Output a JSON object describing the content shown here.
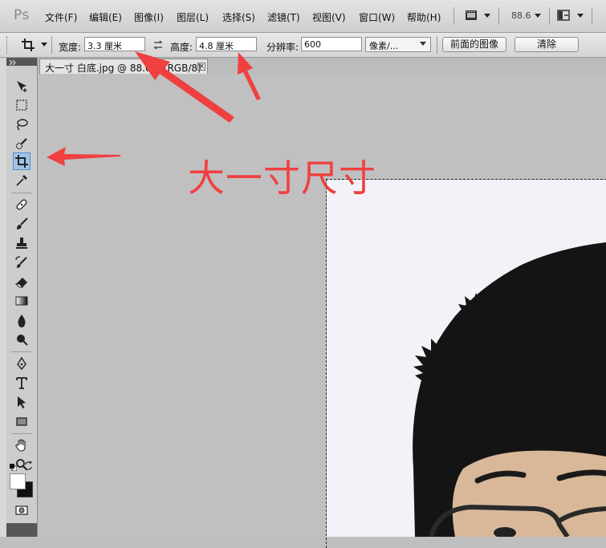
{
  "app": {
    "logo": "Ps"
  },
  "menu": {
    "items": [
      "文件(F)",
      "编辑(E)",
      "图像(I)",
      "图层(L)",
      "选择(S)",
      "滤镜(T)",
      "视图(V)",
      "窗口(W)",
      "帮助(H)"
    ],
    "zoom": "88.6"
  },
  "options": {
    "width_label": "宽度:",
    "width_value": "3.3 厘米",
    "height_label": "高度:",
    "height_value": "4.8 厘米",
    "resolution_label": "分辨率:",
    "resolution_value": "600",
    "unit_select": "像素/...",
    "front_image_button": "前面的图像",
    "clear_button": "清除"
  },
  "document": {
    "tab_title": "大一寸 白底.jpg @ 88.6% (RGB/8)",
    "tab_close": "×"
  },
  "annotation": {
    "text": "大一寸尺寸",
    "color": "#f04040"
  },
  "tools": [
    "move-icon",
    "marquee-icon",
    "lasso-icon",
    "quick-select-icon",
    "crop-icon",
    "eyedropper-icon",
    "healing-brush-icon",
    "brush-icon",
    "clone-stamp-icon",
    "history-brush-icon",
    "eraser-icon",
    "gradient-icon",
    "blur-icon",
    "dodge-icon",
    "pen-icon",
    "type-icon",
    "path-select-icon",
    "rectangle-icon",
    "hand-icon",
    "zoom-icon",
    "default-colors-icon",
    "swap-colors-icon",
    "foreground-color-swatch",
    "quick-mask-icon"
  ]
}
